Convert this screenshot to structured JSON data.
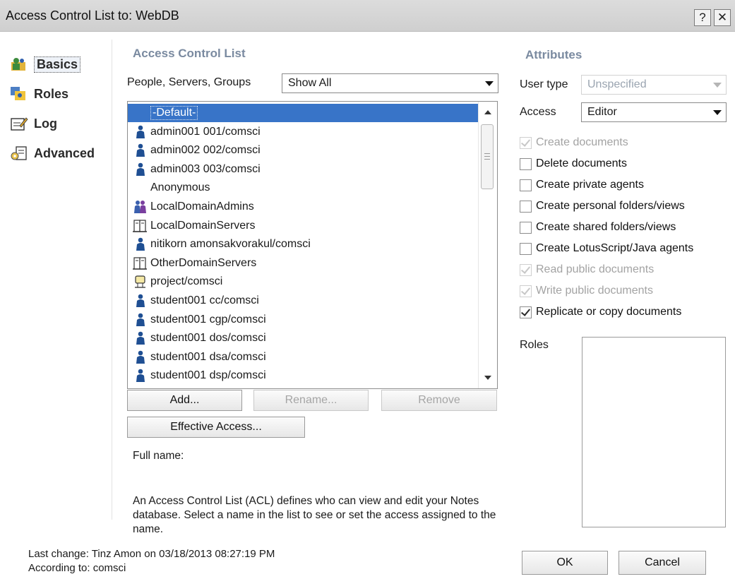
{
  "window": {
    "title": "Access Control List to: WebDB",
    "help_glyph": "?",
    "close_glyph": "✕"
  },
  "nav": [
    {
      "label": "Basics",
      "icon": "basics-icon",
      "active": true
    },
    {
      "label": "Roles",
      "icon": "roles-icon",
      "active": false
    },
    {
      "label": "Log",
      "icon": "log-icon",
      "active": false
    },
    {
      "label": "Advanced",
      "icon": "advanced-icon",
      "active": false
    }
  ],
  "acl": {
    "heading": "Access Control List",
    "filter_label": "People, Servers, Groups",
    "filter_value": "Show All",
    "entries": [
      {
        "name": "-Default-",
        "icon": "none",
        "selected": true
      },
      {
        "name": "admin001 001/comsci",
        "icon": "person-icon"
      },
      {
        "name": "admin002 002/comsci",
        "icon": "person-icon"
      },
      {
        "name": "admin003 003/comsci",
        "icon": "person-icon"
      },
      {
        "name": "Anonymous",
        "icon": "none"
      },
      {
        "name": "LocalDomainAdmins",
        "icon": "group-icon"
      },
      {
        "name": "LocalDomainServers",
        "icon": "server-group-icon"
      },
      {
        "name": "nitikorn amonsakvorakul/comsci",
        "icon": "person-icon"
      },
      {
        "name": "OtherDomainServers",
        "icon": "server-group-icon"
      },
      {
        "name": "project/comsci",
        "icon": "server-icon"
      },
      {
        "name": "student001 cc/comsci",
        "icon": "person-icon"
      },
      {
        "name": "student001 cgp/comsci",
        "icon": "person-icon"
      },
      {
        "name": "student001 dos/comsci",
        "icon": "person-icon"
      },
      {
        "name": "student001 dsa/comsci",
        "icon": "person-icon"
      },
      {
        "name": "student001 dsp/comsci",
        "icon": "person-icon"
      }
    ],
    "buttons": {
      "add": "Add...",
      "rename": "Rename...",
      "remove": "Remove",
      "effective": "Effective Access..."
    },
    "full_name_label": "Full name:",
    "description_lines": [
      "An Access Control List (ACL) defines who can view and edit your Notes",
      "database.  Select a name in the list to see or set the access assigned to the",
      "name."
    ]
  },
  "attributes": {
    "heading": "Attributes",
    "user_type_label": "User type",
    "user_type_value": "Unspecified",
    "access_label": "Access",
    "access_value": "Editor",
    "permissions": [
      {
        "label": "Create documents",
        "checked": true,
        "enabled": false
      },
      {
        "label": "Delete documents",
        "checked": false,
        "enabled": true
      },
      {
        "label": "Create private agents",
        "checked": false,
        "enabled": true
      },
      {
        "label": "Create personal folders/views",
        "checked": false,
        "enabled": true
      },
      {
        "label": "Create shared folders/views",
        "checked": false,
        "enabled": true
      },
      {
        "label": "Create LotusScript/Java agents",
        "checked": false,
        "enabled": true
      },
      {
        "label": "Read public documents",
        "checked": true,
        "enabled": false
      },
      {
        "label": "Write public documents",
        "checked": true,
        "enabled": false
      },
      {
        "label": "Replicate or copy documents",
        "checked": true,
        "enabled": true
      }
    ],
    "roles_label": "Roles"
  },
  "footer": {
    "last_change": "Last change: Tinz Amon on 03/18/2013 08:27:19 PM",
    "according_to": "According to: comsci",
    "ok": "OK",
    "cancel": "Cancel"
  }
}
